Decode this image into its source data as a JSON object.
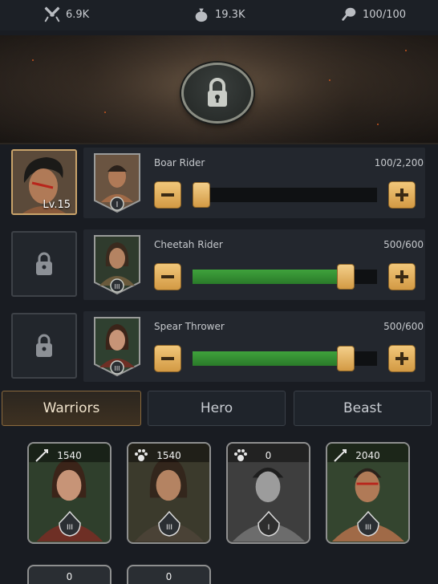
{
  "resources": {
    "power": "6.9K",
    "food": "19.3K",
    "stamina": "100/100"
  },
  "banner": {
    "icon": "lock-icon"
  },
  "hero": {
    "level": "Lv.15"
  },
  "units": [
    {
      "name": "Boar Rider",
      "count": "100/2,200",
      "fill": 0.045,
      "rank": "I"
    },
    {
      "name": "Cheetah Rider",
      "count": "500/600",
      "fill": 0.83,
      "rank": "III"
    },
    {
      "name": "Spear Thrower",
      "count": "500/600",
      "fill": 0.83,
      "rank": "III"
    }
  ],
  "tabs": [
    {
      "label": "Warriors",
      "active": true
    },
    {
      "label": "Hero",
      "active": false
    },
    {
      "label": "Beast",
      "active": false
    }
  ],
  "cards": [
    {
      "value": "1540",
      "type_icon": "spear-icon",
      "rank": "III",
      "gray": false
    },
    {
      "value": "1540",
      "type_icon": "paw-icon",
      "rank": "III",
      "gray": false
    },
    {
      "value": "0",
      "type_icon": "paw-icon",
      "rank": "I",
      "gray": true
    },
    {
      "value": "2040",
      "type_icon": "spear-icon",
      "rank": "III",
      "gray": false
    }
  ],
  "cards_row2": [
    {
      "value": "0"
    },
    {
      "value": "0"
    }
  ],
  "colors": {
    "accent_gold": "#d39a44",
    "fill_green": "#3fa23c",
    "active_tab": "#8a6a3d"
  }
}
